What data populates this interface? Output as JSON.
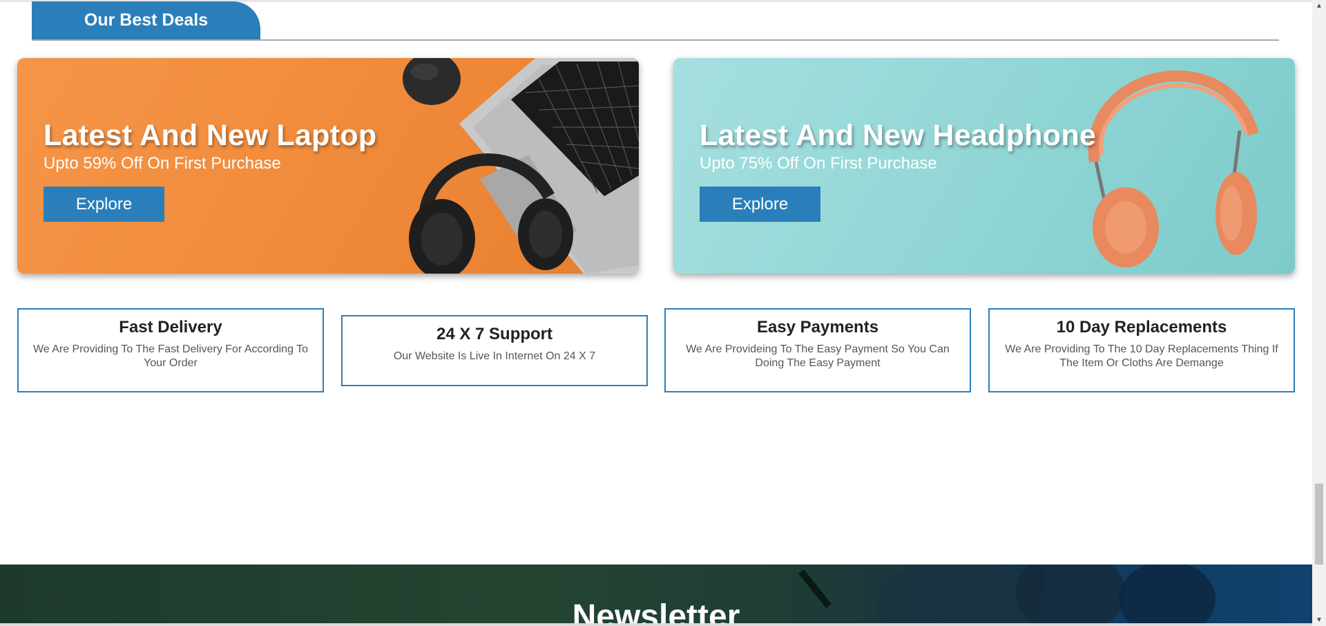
{
  "section": {
    "heading": "Our Best Deals"
  },
  "deals": [
    {
      "title": "Latest And New Laptop",
      "subtitle": "Upto 59% Off On First Purchase",
      "button_label": "Explore"
    },
    {
      "title": "Latest And New Headphone",
      "subtitle": "Upto 75% Off On First Purchase",
      "button_label": "Explore"
    }
  ],
  "features": [
    {
      "title": "Fast Delivery",
      "text": "We Are Providing To The Fast Delivery For According To Your Order"
    },
    {
      "title": "24 X 7 Support",
      "text": "Our Website Is Live In Internet On 24 X 7"
    },
    {
      "title": "Easy Payments",
      "text": "We Are Provideing To The Easy Payment So You Can Doing The Easy Payment"
    },
    {
      "title": "10 Day Replacements",
      "text": "We Are Providing To The 10 Day Replacements Thing If The Item Or Cloths Are Demange"
    }
  ],
  "newsletter": {
    "heading": "Newsletter"
  },
  "icons": {
    "scroll_up": "chevron-up-icon",
    "scroll_down": "chevron-down-icon"
  },
  "colors": {
    "accent": "#2a7fba",
    "laptop_banner": "#f08a3a",
    "headphone_banner": "#8fd5d4",
    "newsletter_bg": "#244532"
  }
}
